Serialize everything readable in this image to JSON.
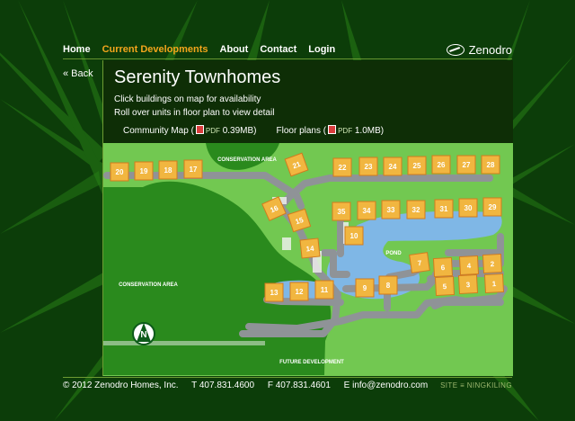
{
  "nav": {
    "items": [
      {
        "label": "Home",
        "active": false
      },
      {
        "label": "Current Developments",
        "active": true
      },
      {
        "label": "About",
        "active": false
      },
      {
        "label": "Contact",
        "active": false
      },
      {
        "label": "Login",
        "active": false
      }
    ]
  },
  "logo": {
    "name": "Zenodro"
  },
  "back": {
    "label": "« Back"
  },
  "page": {
    "title": "Serenity Townhomes",
    "instructions": [
      "Click buildings on map for availability",
      "Roll over units in floor plan to view detail"
    ],
    "links": [
      {
        "label": "Community Map",
        "file_type": "PDF",
        "size": "0.39MB"
      },
      {
        "label": "Floor plans",
        "file_type": "PDF",
        "size": "1.0MB"
      }
    ]
  },
  "map": {
    "labels": {
      "top_conservation": "CONSERVATION AREA",
      "left_conservation": "CONSERVATION AREA",
      "pond": "POND",
      "future": "FUTURE DEVELOPMENT",
      "north": "N"
    },
    "buildings": [
      "1",
      "2",
      "3",
      "4",
      "5",
      "6",
      "7",
      "8",
      "9",
      "10",
      "11",
      "12",
      "13",
      "14",
      "15",
      "16",
      "17",
      "18",
      "19",
      "20",
      "21",
      "22",
      "23",
      "24",
      "25",
      "26",
      "27",
      "28",
      "29",
      "30",
      "31",
      "32",
      "33",
      "34",
      "35"
    ],
    "colors": {
      "building": "#f1b640",
      "grass": "#6cc04a",
      "water": "#7fb7e6",
      "road": "#8f9397"
    }
  },
  "footer": {
    "copyright": "© 2012 Zenodro Homes, Inc.",
    "tel": "T 407.831.4600",
    "fax": "F 407.831.4601",
    "email": "E info@zenodro.com",
    "site": "SITE ≡ NINGKILING"
  }
}
